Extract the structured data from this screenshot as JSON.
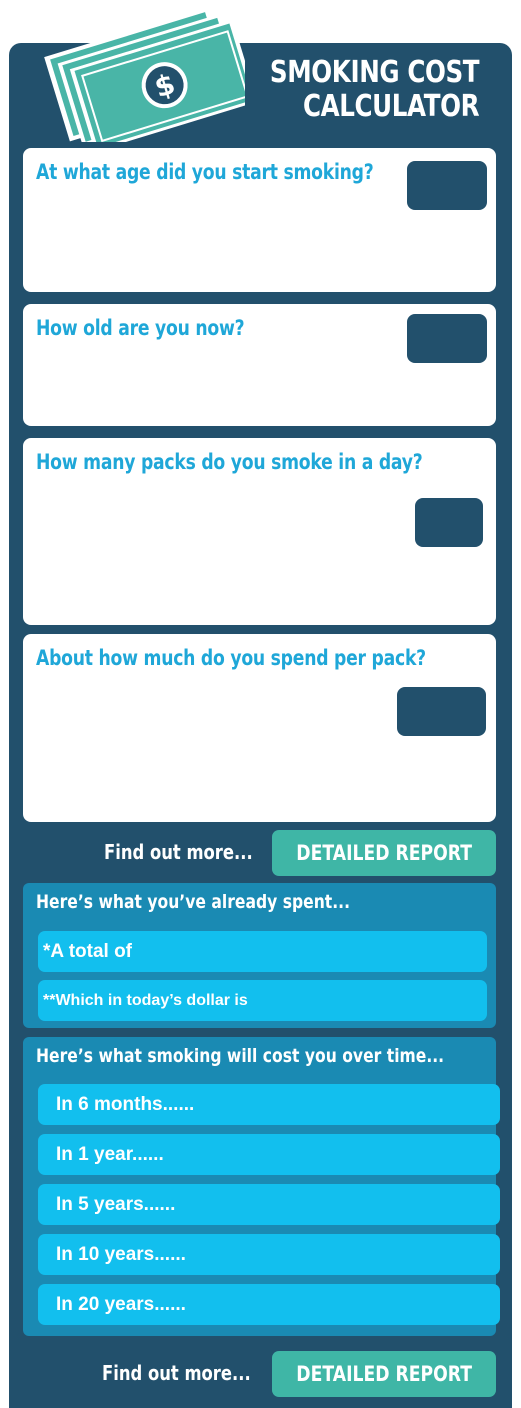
{
  "title": {
    "line1": "SMOKING COST",
    "line2": "CALCULATOR"
  },
  "icons": {
    "money": "dollar-bills-icon"
  },
  "colors": {
    "panel": "#22506c",
    "accent_blue": "#1fa7d8",
    "teal_button": "#3fb6a6",
    "result_box": "#1a8ab3",
    "result_bar": "#12bfee"
  },
  "questions": [
    {
      "label": "At what age did you start smoking?",
      "value": ""
    },
    {
      "label": "How old are you now?",
      "value": ""
    },
    {
      "label": "How many packs do you smoke in a day?",
      "value": ""
    },
    {
      "label": "About how much do you spend per pack?",
      "value": ""
    }
  ],
  "find_out_more": "Find out more...",
  "detailed_report": "DETAILED REPORT",
  "spent": {
    "heading": "Here’s what you’ve already spent...",
    "rows": [
      "*A total of",
      "**Which in today’s dollar is"
    ]
  },
  "future": {
    "heading": "Here’s what smoking will cost you over time...",
    "rows": [
      "In 6 months......",
      "In 1 year......",
      "In 5 years......",
      "In 10 years......",
      "In 20 years......"
    ]
  }
}
